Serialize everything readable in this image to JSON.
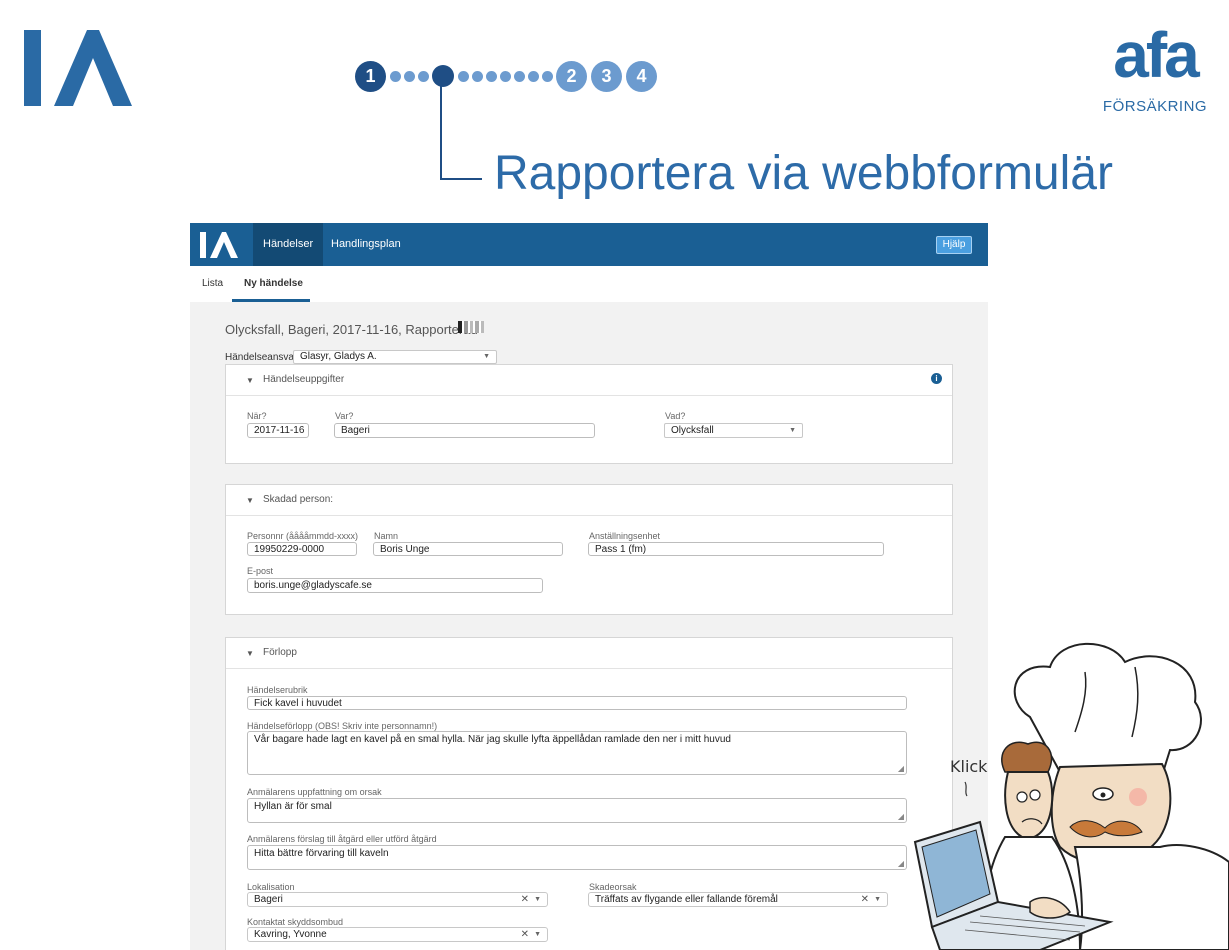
{
  "slide": {
    "progress": {
      "step1": "1",
      "step2": "2",
      "step3": "3",
      "step4": "4"
    },
    "title": "Rapportera via webbformulär",
    "afa_word": "afa",
    "afa_sub": "FÖRSÄKRING",
    "illustration_text": "Klick"
  },
  "app": {
    "nav": {
      "events": "Händelser",
      "action_plan": "Handlingsplan",
      "help": "Hjälp"
    },
    "tabs": {
      "list": "Lista",
      "new_event": "Ny händelse"
    },
    "event_title": "Olycksfall, Bageri, 2017-11-16, Rapporterad",
    "owner": {
      "label": "Händelseansvarig:",
      "value": "Glasyr, Gladys A."
    },
    "section_details": {
      "title": "Händelseuppgifter",
      "when_label": "När?",
      "when_value": "2017-11-16",
      "where_label": "Var?",
      "where_value": "Bageri",
      "what_label": "Vad?",
      "what_value": "Olycksfall"
    },
    "section_person": {
      "title": "Skadad person:",
      "pnr_label": "Personnr (ååååmmdd-xxxx)",
      "pnr_value": "19950229-0000",
      "name_label": "Namn",
      "name_value": "Boris Unge",
      "unit_label": "Anställningsenhet",
      "unit_value": "Pass 1 (fm)",
      "email_label": "E-post",
      "email_value": "boris.unge@gladyscafe.se"
    },
    "section_course": {
      "title": "Förlopp",
      "headline_label": "Händelserubrik",
      "headline_value": "Fick kavel i huvudet",
      "description_label": "Händelseförlopp (OBS! Skriv inte personnamn!)",
      "description_value": "Vår bagare hade lagt en kavel på en smal hylla. När jag skulle lyfta äppellådan ramlade den ner i mitt huvud",
      "cause_label": "Anmälarens uppfattning om orsak",
      "cause_value": "Hyllan är för smal",
      "proposal_label": "Anmälarens förslag till åtgärd eller utförd åtgärd",
      "proposal_value": "Hitta bättre förvaring till kaveln",
      "location_label": "Lokalisation",
      "location_value": "Bageri",
      "damage_cause_label": "Skadeorsak",
      "damage_cause_value": "Träffats av flygande eller fallande föremål",
      "safety_rep_label": "Kontaktat skyddsombud",
      "safety_rep_value": "Kavring, Yvonne"
    }
  }
}
